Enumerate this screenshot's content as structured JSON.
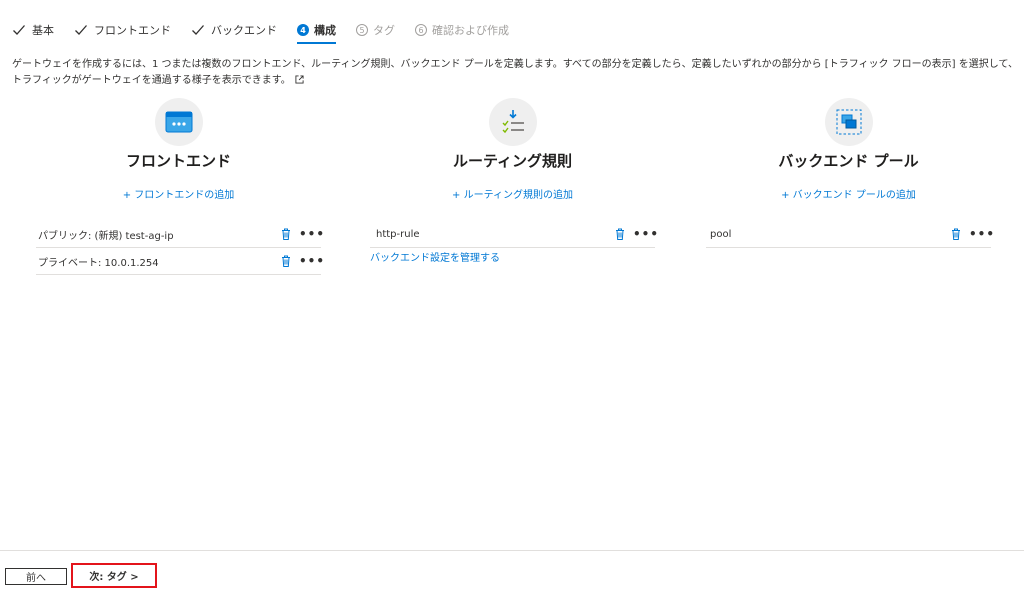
{
  "tabs": [
    {
      "label": "基本",
      "state": "done"
    },
    {
      "label": "フロントエンド",
      "state": "done"
    },
    {
      "label": "バックエンド",
      "state": "done"
    },
    {
      "label": "構成",
      "state": "active",
      "num": "4"
    },
    {
      "label": "タグ",
      "state": "disabled",
      "num": "5"
    },
    {
      "label": "確認および作成",
      "state": "disabled",
      "num": "6"
    }
  ],
  "description": "ゲートウェイを作成するには、1 つまたは複数のフロントエンド、ルーティング規則、バックエンド プールを定義します。すべての部分を定義したら、定義したいずれかの部分から [トラフィック フローの表示] を選択して、トラフィックがゲートウェイを通過する様子を表示できます。",
  "frontend": {
    "title": "フロントエンド",
    "add": "+ フロントエンドの追加",
    "items": [
      "パブリック: (新規) test-ag-ip",
      "プライベート: 10.0.1.254"
    ]
  },
  "routing": {
    "title": "ルーティング規則",
    "add": "+ ルーティング規則の追加",
    "items": [
      "http-rule"
    ],
    "manage": "バックエンド設定を管理する"
  },
  "backend": {
    "title": "バックエンド プール",
    "add": "+ バックエンド プールの追加",
    "items": [
      "pool"
    ]
  },
  "footer": {
    "prev": "前へ",
    "next": "次: タグ >"
  },
  "colors": {
    "accent": "#0078d4",
    "highlight": "#e3141b",
    "disabled": "#a19f9d"
  }
}
